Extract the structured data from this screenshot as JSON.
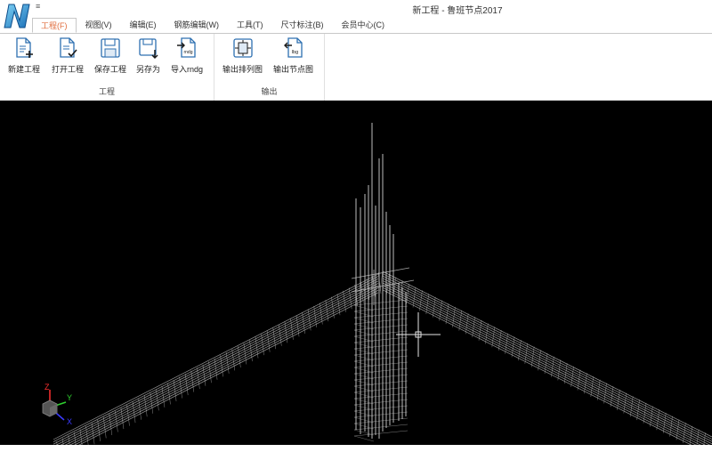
{
  "window": {
    "title": "新工程 - 鲁班节点2017",
    "quick_access": "≡"
  },
  "tabs": [
    {
      "label": "工程(F)",
      "active": true
    },
    {
      "label": "视图(V)"
    },
    {
      "label": "编辑(E)"
    },
    {
      "label": "钢筋编辑(W)"
    },
    {
      "label": "工具(T)"
    },
    {
      "label": "尺寸标注(B)"
    },
    {
      "label": "会员中心(C)"
    }
  ],
  "ribbon": {
    "group_project": {
      "label": "工程",
      "buttons": [
        {
          "label": "新建工程",
          "icon": "new-file-icon"
        },
        {
          "label": "打开工程",
          "icon": "open-file-icon"
        },
        {
          "label": "保存工程",
          "icon": "save-icon"
        },
        {
          "label": "另存为",
          "icon": "save-as-icon"
        },
        {
          "label": "导入rndg",
          "icon": "import-rndg-icon",
          "badge": "rndg"
        }
      ]
    },
    "group_output": {
      "label": "输出",
      "buttons": [
        {
          "label": "输出排列图",
          "icon": "export-layout-icon"
        },
        {
          "label": "输出节点图",
          "icon": "export-node-icon",
          "badge": "lbg"
        }
      ]
    }
  },
  "viewport": {
    "axes": {
      "x": "X",
      "y": "Y",
      "z": "Z"
    },
    "colors": {
      "background": "#000000",
      "wire": "#cfcfcf",
      "axis_x": "#3a3aff",
      "axis_y": "#2fd02f",
      "axis_z": "#ff3030"
    }
  }
}
